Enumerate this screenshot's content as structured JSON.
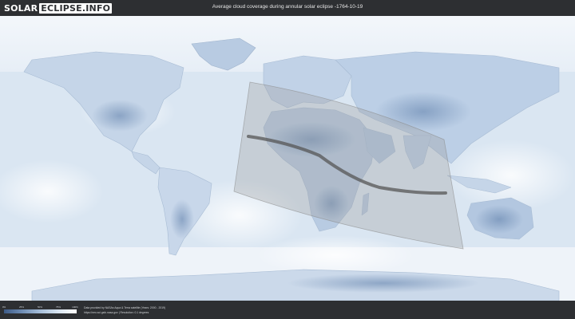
{
  "header": {
    "logo_part1": "SOLAR",
    "logo_part2": "ECLIPSE.INFO",
    "title": "Average cloud coverage during annular solar eclipse -1764-10-19"
  },
  "legend": {
    "ticks": [
      "0%",
      "25%",
      "50%",
      "75%",
      "100%"
    ],
    "colors": [
      "#3d5b87",
      "#6f8db4",
      "#a7bfda",
      "#d9e5f1",
      "#ffffff"
    ]
  },
  "credits": {
    "line1": "Data provided by NASAs Aqua & Terra satellite (Years: 2000 - 2019)",
    "line2": "https://neo.sci.gsfc.nasa.gov  |  Resolution: 0.1 degrees"
  },
  "colors": {
    "ocean": "#dfe9f4",
    "land": "#bccde2",
    "cloud_dense": "#f3f7fb",
    "clear_sky": "#5f7fab",
    "eclipse_zone": "#9a9a9a",
    "central_path": "#555555",
    "bar_background": "#2d2f32"
  }
}
